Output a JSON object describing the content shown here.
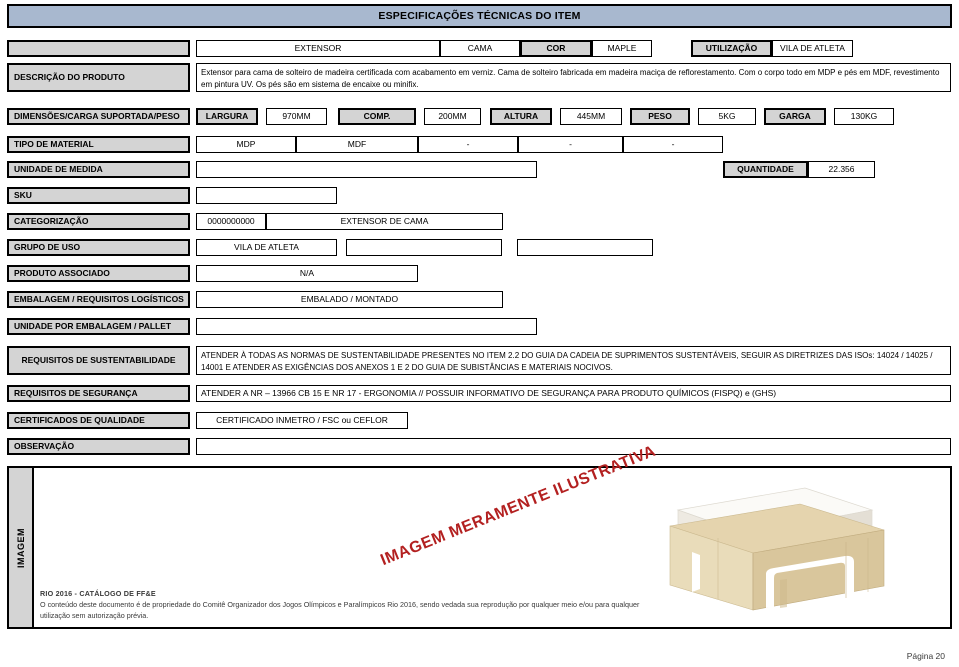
{
  "banner": {
    "title": "ESPECIFICAÇÕES TÉCNICAS DO ITEM"
  },
  "header_row": {
    "blank_label": "",
    "item_name": "EXTENSOR",
    "item_type": "CAMA",
    "color_label": "COR",
    "color_value": "MAPLE",
    "usage_label": "UTILIZAÇÃO",
    "usage_value": "VILA DE ATLETA"
  },
  "description": {
    "label": "DESCRIÇÃO DO PRODUTO",
    "text": "Extensor para cama de solteiro de madeira certificada com acabamento em verniz. Cama de solteiro fabricada em madeira maciça de reflorestamento. Com o corpo todo em MDP e pés em MDF, revestimento em pintura UV. Os pés são em sistema de encaixe ou minifix."
  },
  "dimensions": {
    "label": "DIMENSÕES/CARGA SUPORTADA/PESO",
    "fields": [
      {
        "label": "LARGURA",
        "value": "970MM"
      },
      {
        "label": "COMP.",
        "value": "200MM"
      },
      {
        "label": "ALTURA",
        "value": "445MM"
      },
      {
        "label": "PESO",
        "value": "5KG"
      },
      {
        "label": "GARGA",
        "value": "130KG"
      }
    ]
  },
  "material": {
    "label": "TIPO DE MATERIAL",
    "values": [
      "MDP",
      "MDF",
      "-",
      "-",
      "-"
    ]
  },
  "unit_measure": {
    "label": "UNIDADE DE MEDIDA",
    "value": "",
    "quantity_label": "QUANTIDADE",
    "quantity_value": "22.356"
  },
  "sku": {
    "label": "SKU",
    "value": ""
  },
  "categorization": {
    "label": "CATEGORIZAÇÃO",
    "code": "0000000000",
    "name": "EXTENSOR DE CAMA"
  },
  "usage_group": {
    "label": "GRUPO DE USO",
    "value1": "VILA DE ATLETA",
    "value2": "",
    "value3": ""
  },
  "associated_product": {
    "label": "PRODUTO ASSOCIADO",
    "value": "N/A"
  },
  "packaging": {
    "label": "EMBALAGEM / REQUISITOS LOGÍSTICOS",
    "value": "EMBALADO / MONTADO"
  },
  "unit_per_package": {
    "label": "UNIDADE POR EMBALAGEM / PALLET",
    "value": ""
  },
  "sustainability": {
    "label": "REQUISITOS DE SUSTENTABILIDADE",
    "text": "ATENDER À TODAS AS NORMAS DE SUSTENTABILIDADE PRESENTES NO ITEM 2.2 DO GUIA DA CADEIA DE SUPRIMENTOS SUSTENTÁVEIS, SEGUIR AS DIRETRIZES DAS ISOs: 14024 / 14025 / 14001 E ATENDER AS EXIGÊNCIAS DOS ANEXOS 1 E 2 DO GUIA DE SUBISTÂNCIAS E MATERIAIS NOCIVOS."
  },
  "safety": {
    "label": "REQUISITOS DE SEGURANÇA",
    "text": "ATENDER A NR – 13966  CB 15 E NR 17 - ERGONOMIA // POSSUIR INFORMATIVO DE SEGURANÇA PARA PRODUTO QUÍMICOS (FISPQ) e (GHS)"
  },
  "quality": {
    "label": "CERTIFICADOS DE QUALIDADE",
    "text": "CERTIFICADO INMETRO / FSC ou CEFLOR"
  },
  "observation": {
    "label": "OBSERVAÇÃO",
    "value": ""
  },
  "image_section": {
    "spine_label": "IMAGEM",
    "watermark": "IMAGEM MERAMENTE ILUSTRATIVA",
    "copyright_title": "RIO 2016 - CATÁLOGO DE FF&E",
    "copyright_text": "O conteúdo deste documento é de propriedade do Comitê Organizador dos Jogos Olímpicos e Paralímpicos Rio 2016, sendo vedada sua reprodução por qualquer meio e/ou para qualquer utilização sem autorização prévia."
  },
  "footer": {
    "page": "Página 20"
  },
  "colors": {
    "banner": "#a8b8cf",
    "label_gray": "#d4d4d4",
    "watermark_red": "#b32020",
    "wood_light": "#e8d9b5",
    "wood_mid": "#d8c49a",
    "wood_dark": "#c9b184",
    "cushion": "#f7f4ee"
  }
}
